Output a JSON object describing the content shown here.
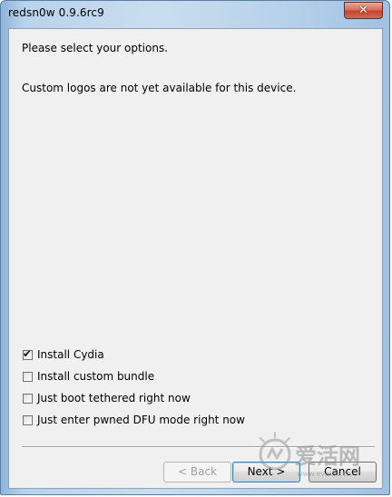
{
  "window": {
    "title": "redsn0w 0.9.6rc9",
    "close_glyph": "✕"
  },
  "content": {
    "prompt": "Please select your options.",
    "notice": "Custom logos are not yet available for this device."
  },
  "options": [
    {
      "label": "Install Cydia",
      "checked": true
    },
    {
      "label": "Install custom bundle",
      "checked": false
    },
    {
      "label": "Just boot tethered right now",
      "checked": false
    },
    {
      "label": "Just enter pwned DFU mode right now",
      "checked": false
    }
  ],
  "buttons": {
    "back": "< Back",
    "next": "Next >",
    "cancel": "Cancel"
  },
  "watermark": {
    "text": "爱活网",
    "subtext": "www.evolife.cn"
  },
  "colors": {
    "frame": "#b8d3ec",
    "client": "#f0f0f0",
    "close": "#c2452d"
  }
}
